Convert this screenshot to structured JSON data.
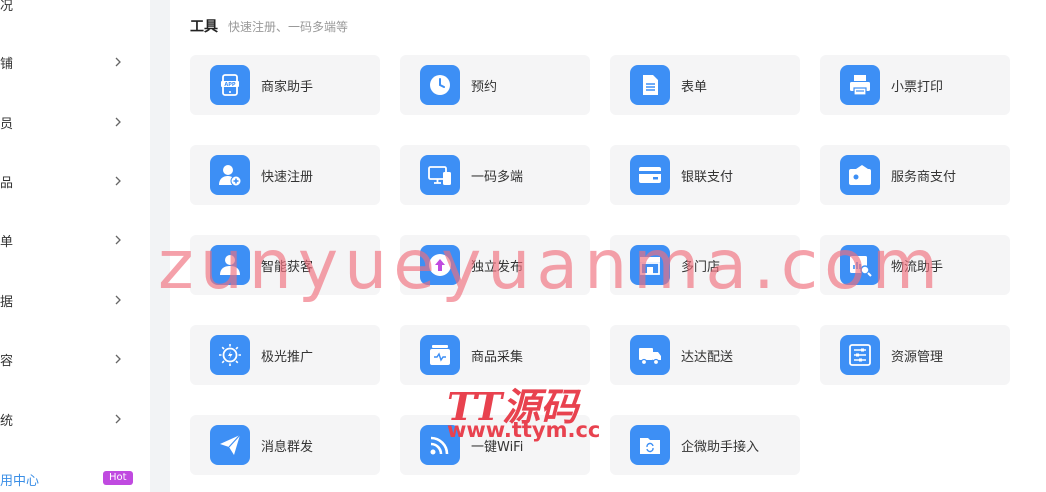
{
  "sidebar": {
    "items": [
      {
        "label": "况"
      },
      {
        "label": "铺"
      },
      {
        "label": "员"
      },
      {
        "label": "品"
      },
      {
        "label": "单"
      },
      {
        "label": "据"
      },
      {
        "label": "容"
      },
      {
        "label": "统"
      },
      {
        "label": "用中心",
        "badge": "Hot"
      }
    ]
  },
  "section": {
    "title": "工具",
    "subtitle": "快速注册、一码多端等"
  },
  "tools": [
    {
      "label": "商家助手",
      "icon": "app-icon"
    },
    {
      "label": "预约",
      "icon": "clock-icon"
    },
    {
      "label": "表单",
      "icon": "document-icon"
    },
    {
      "label": "小票打印",
      "icon": "printer-icon"
    },
    {
      "label": "快速注册",
      "icon": "user-add-icon"
    },
    {
      "label": "一码多端",
      "icon": "devices-icon"
    },
    {
      "label": "银联支付",
      "icon": "card-icon"
    },
    {
      "label": "服务商支付",
      "icon": "wallet-icon"
    },
    {
      "label": "智能获客",
      "icon": "user-icon"
    },
    {
      "label": "独立发布",
      "icon": "upload-icon"
    },
    {
      "label": "多门店",
      "icon": "store-icon"
    },
    {
      "label": "物流助手",
      "icon": "logistics-icon"
    },
    {
      "label": "极光推广",
      "icon": "aurora-icon"
    },
    {
      "label": "商品采集",
      "icon": "collect-icon"
    },
    {
      "label": "达达配送",
      "icon": "truck-icon"
    },
    {
      "label": "资源管理",
      "icon": "sliders-icon"
    },
    {
      "label": "消息群发",
      "icon": "send-icon"
    },
    {
      "label": "一键WiFi",
      "icon": "wifi-icon"
    },
    {
      "label": "企微助手接入",
      "icon": "folder-sync-icon"
    }
  ],
  "watermark": {
    "main": "zunyueyuanma.com",
    "logo": "TT源码",
    "url": "www.ttym.cc"
  },
  "colors": {
    "accent": "#3d8ff5",
    "badge": "#c04ae0",
    "tile_bg": "#f5f5f6",
    "watermark": "#f07a86"
  }
}
